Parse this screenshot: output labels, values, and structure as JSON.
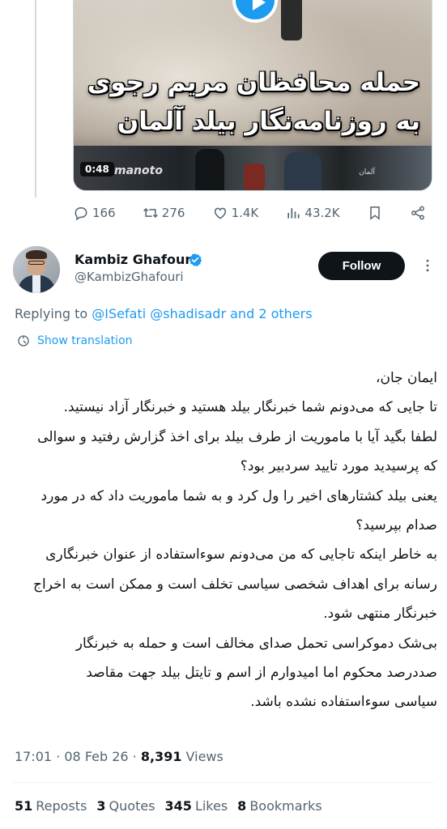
{
  "previous_tweet": {
    "video": {
      "title_line1": "حمله محافظان مریم رجوی",
      "title_line2": "به روزنامه‌نگار بیلد آلمان",
      "duration": "0:48",
      "watermark": "manoto",
      "tag": "آلمان"
    },
    "actions": {
      "replies": "166",
      "reposts": "276",
      "likes": "1.4K",
      "views": "43.2K"
    }
  },
  "tweet": {
    "author": {
      "name": "Kambiz Ghafouri",
      "handle": "@KambizGhafouri",
      "verified": true
    },
    "follow_label": "Follow",
    "replying": {
      "prefix": "Replying to",
      "mention1": "@ISefati",
      "mention2": "@shadisadr",
      "suffix": "and 2 others"
    },
    "translate_label": "Show translation",
    "lines": [
      "ایمان جان،",
      "تا جایی که می‌دونم شما خبرنگار بیلد هستید و خبرنگار آزاد نیستید.",
      "لطفا بگید آیا با ماموریت از طرف بیلد برای اخذ گزارش رفتید و سوالی",
      "که پرسیدید مورد تایید سردبیر بود؟",
      "یعنی بیلد کشتارهای اخیر را ول کرد و به شما ماموریت داد که در مورد",
      "صدام بپرسید؟",
      "به خاطر اینکه تاجایی که من می‌دونم سوءاستفاده از عنوان خبرنگاری",
      "رسانه برای اهداف شخصی سیاسی تخلف است و ممکن است به اخراج",
      "خبرنگار منتهی شود.",
      "بی‌شک دموکراسی تحمل صدای مخالف است و حمله به خبرنگار",
      "صددرصد محکوم اما امیدوارم از اسم و تایتل بیلد جهت مقاصد",
      "سیاسی سوءاستفاده نشده باشد."
    ],
    "timestamp": "17:01 · 08 Feb 26 · ",
    "views_count": "8,391",
    "views_label": "Views",
    "stats": {
      "reposts_count": "51",
      "reposts_label": "Reposts",
      "quotes_count": "3",
      "quotes_label": "Quotes",
      "likes_count": "345",
      "likes_label": "Likes",
      "bookmarks_count": "8",
      "bookmarks_label": "Bookmarks"
    }
  },
  "colors": {
    "accent": "#1d9bf0",
    "text_primary": "#0f1419",
    "text_secondary": "#536471"
  },
  "icons": [
    "play-icon",
    "reply-icon",
    "repost-icon",
    "like-icon",
    "views-icon",
    "bookmark-icon",
    "share-icon",
    "verified-icon",
    "more-icon",
    "translate-icon"
  ]
}
